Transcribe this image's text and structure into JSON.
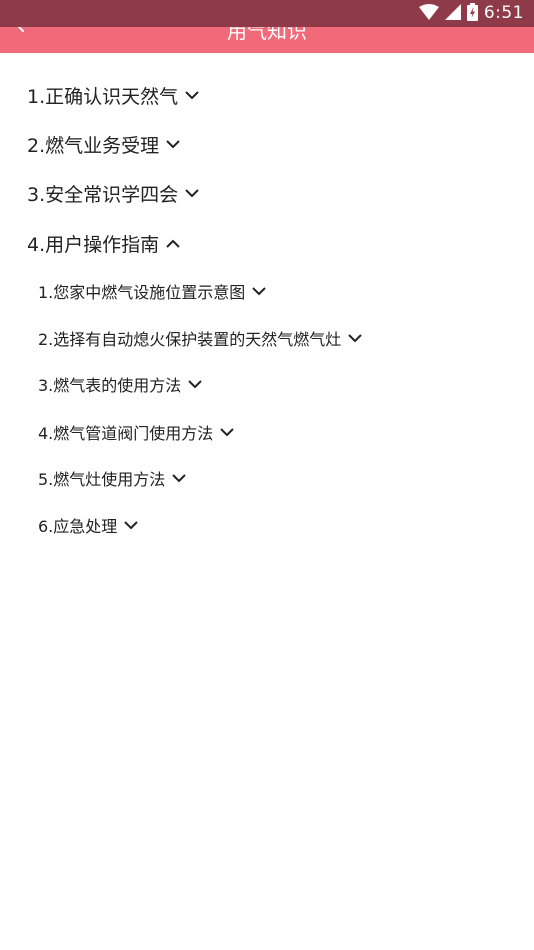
{
  "status_bar": {
    "time": "6:51",
    "icons": [
      "wifi-icon",
      "cell-signal-icon",
      "battery-icon"
    ]
  },
  "app_bar": {
    "title": "用气知识",
    "back_icon": "arrow-left-icon",
    "color": "#f06a79"
  },
  "sections": [
    {
      "label": "1.正确认识天然气",
      "expanded": false
    },
    {
      "label": "2.燃气业务受理",
      "expanded": false
    },
    {
      "label": "3.安全常识学四会",
      "expanded": false
    },
    {
      "label": "4.用户操作指南",
      "expanded": true,
      "items": [
        {
          "label": "1.您家中燃气设施位置示意图"
        },
        {
          "label": "2.选择有自动熄火保护装置的天然气燃气灶"
        },
        {
          "label": "3.燃气表的使用方法"
        },
        {
          "label": "4.燃气管道阀门使用方法"
        },
        {
          "label": "5.燃气灶使用方法"
        },
        {
          "label": "6.应急处理"
        }
      ]
    }
  ]
}
